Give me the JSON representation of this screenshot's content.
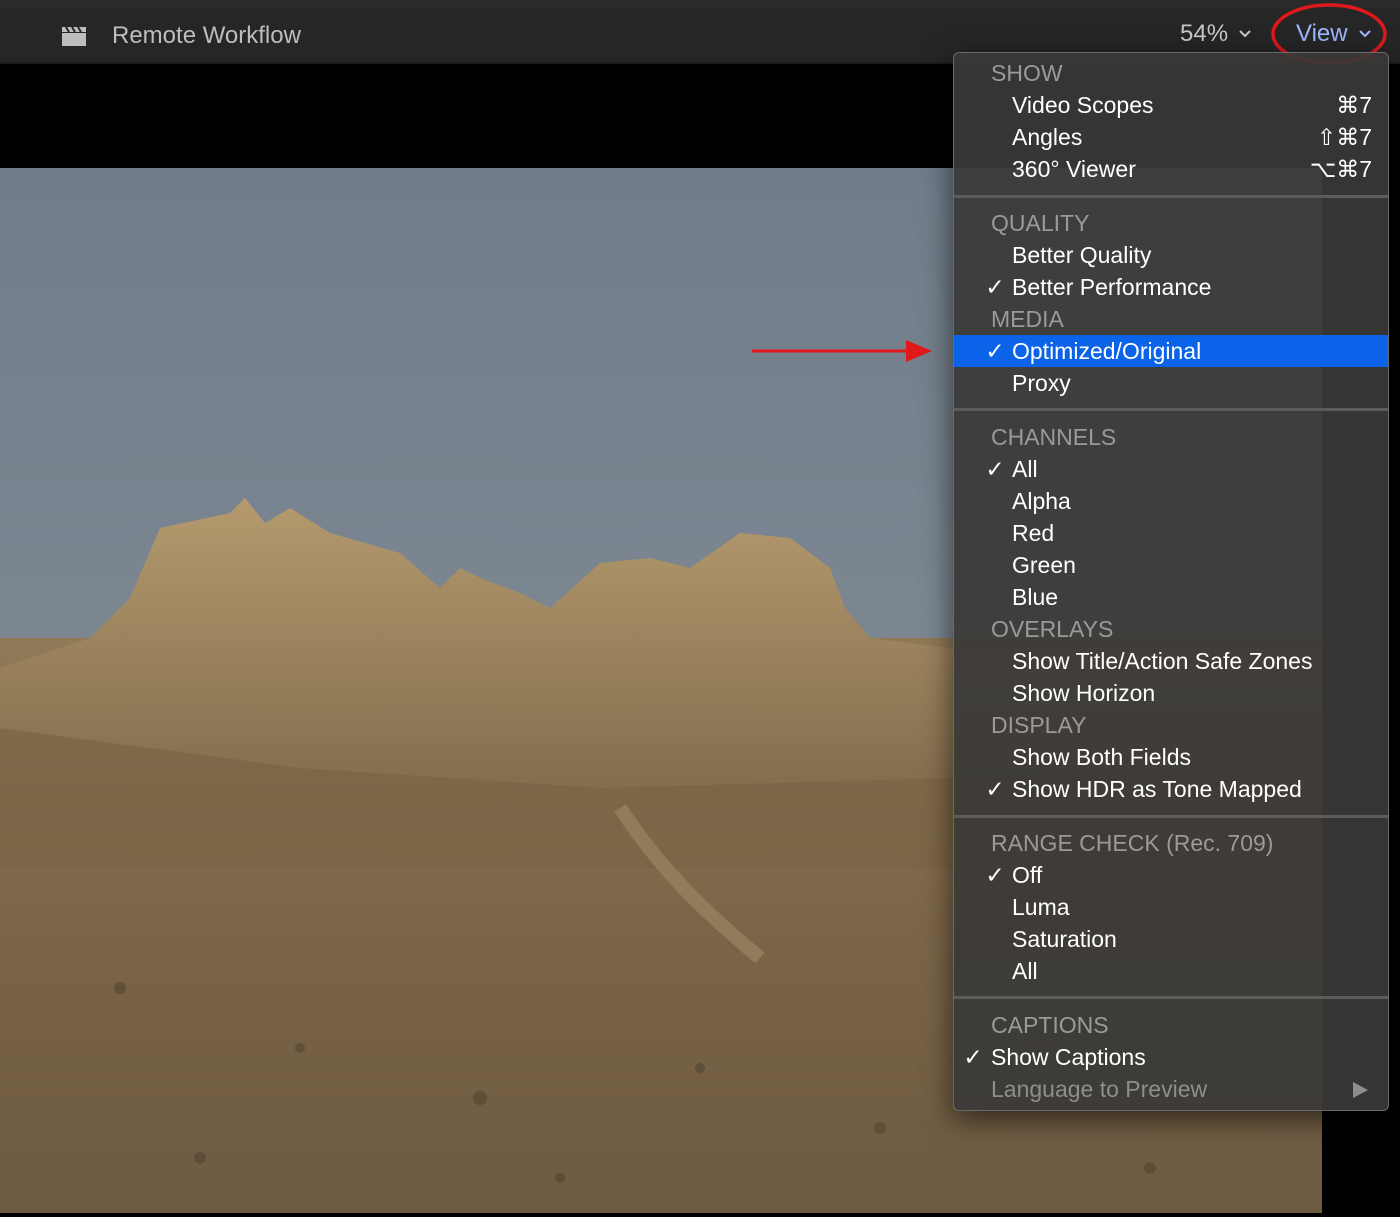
{
  "titlebar": {
    "title": "Remote Workflow",
    "icon": "clapperboard-icon",
    "zoom": "54%",
    "view_label": "View"
  },
  "colors": {
    "accent": "#0a63e8",
    "view_label": "#9db8ff",
    "annotation": "#e0191b"
  },
  "menu": {
    "show_header": "SHOW",
    "video_scopes": "Video Scopes",
    "video_scopes_shortcut": "⌘7",
    "angles": "Angles",
    "angles_shortcut": "⇧⌘7",
    "viewer360": "360° Viewer",
    "viewer360_shortcut": "⌥⌘7",
    "quality_header": "QUALITY",
    "better_quality": "Better Quality",
    "better_performance": "Better Performance",
    "media_header": "MEDIA",
    "optimized_original": "Optimized/Original",
    "proxy": "Proxy",
    "channels_header": "CHANNELS",
    "ch_all": "All",
    "ch_alpha": "Alpha",
    "ch_red": "Red",
    "ch_green": "Green",
    "ch_blue": "Blue",
    "overlays_header": "OVERLAYS",
    "safe_zones": "Show Title/Action Safe Zones",
    "horizon": "Show Horizon",
    "display_header": "DISPLAY",
    "both_fields": "Show Both Fields",
    "hdr_tone": "Show HDR as Tone Mapped",
    "range_header": "RANGE CHECK (Rec. 709)",
    "range_off": "Off",
    "range_luma": "Luma",
    "range_saturation": "Saturation",
    "range_all": "All",
    "captions_header": "CAPTIONS",
    "show_captions": "Show Captions",
    "language_preview": "Language to Preview",
    "checkmark": "✓"
  }
}
